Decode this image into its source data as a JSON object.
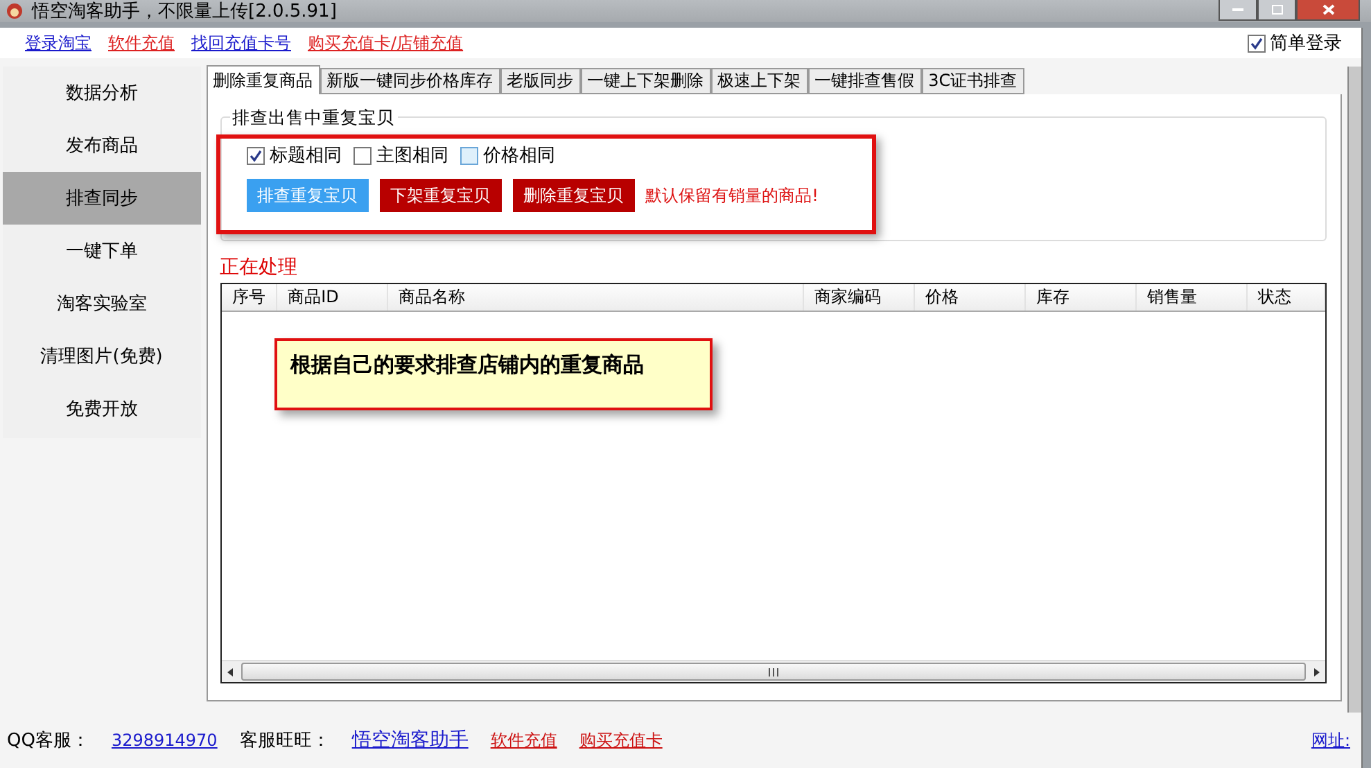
{
  "window": {
    "title": "悟空淘客助手，不限量上传[2.0.5.91]"
  },
  "top_links": [
    {
      "text": "登录淘宝",
      "color": "#1a1acc"
    },
    {
      "text": "软件充值",
      "color": "#dd2222"
    },
    {
      "text": "找回充值卡号",
      "color": "#1a1acc"
    },
    {
      "text": "购买充值卡/店铺充值",
      "color": "#dd2222"
    }
  ],
  "simple_login": {
    "label": "简单登录",
    "checked": true
  },
  "sidebar": {
    "items": [
      {
        "label": "数据分析",
        "selected": false
      },
      {
        "label": "发布商品",
        "selected": false
      },
      {
        "label": "排查同步",
        "selected": true
      },
      {
        "label": "一键下单",
        "selected": false
      },
      {
        "label": "淘客实验室",
        "selected": false
      },
      {
        "label": "清理图片(免费)",
        "selected": false
      },
      {
        "label": "免费开放",
        "selected": false
      }
    ]
  },
  "tabs": [
    {
      "label": "删除重复商品",
      "selected": true
    },
    {
      "label": "新版一键同步价格库存",
      "selected": false
    },
    {
      "label": "老版同步",
      "selected": false
    },
    {
      "label": "一键上下架删除",
      "selected": false
    },
    {
      "label": "极速上下架",
      "selected": false
    },
    {
      "label": "一键排查售假",
      "selected": false
    },
    {
      "label": "3C证书排查",
      "selected": false
    }
  ],
  "group": {
    "title": "排查出售中重复宝贝",
    "options": [
      {
        "label": "标题相同",
        "checked": true
      },
      {
        "label": "主图相同",
        "checked": false
      },
      {
        "label": "价格相同",
        "checked": false
      }
    ],
    "buttons": [
      {
        "label": "排查重复宝贝",
        "kind": "primary"
      },
      {
        "label": "下架重复宝贝",
        "kind": "danger"
      },
      {
        "label": "删除重复宝贝",
        "kind": "danger"
      }
    ],
    "note": "默认保留有销量的商品!"
  },
  "status_text": "正在处理",
  "annotation": "根据自己的要求排查店铺内的重复商品",
  "table": {
    "columns": [
      "序号",
      "商品ID",
      "商品名称",
      "商家编码",
      "价格",
      "库存",
      "销售量",
      "状态"
    ]
  },
  "footer": {
    "qq_label": "QQ客服：",
    "qq_value": "3298914970",
    "wangwang_label": "客服旺旺：",
    "links": [
      {
        "text": "悟空淘客助手",
        "color": "#1a1acc"
      },
      {
        "text": "软件充值",
        "color": "#cc1111"
      },
      {
        "text": "购买充值卡",
        "color": "#cc1111"
      }
    ],
    "site_label": "网址:"
  }
}
